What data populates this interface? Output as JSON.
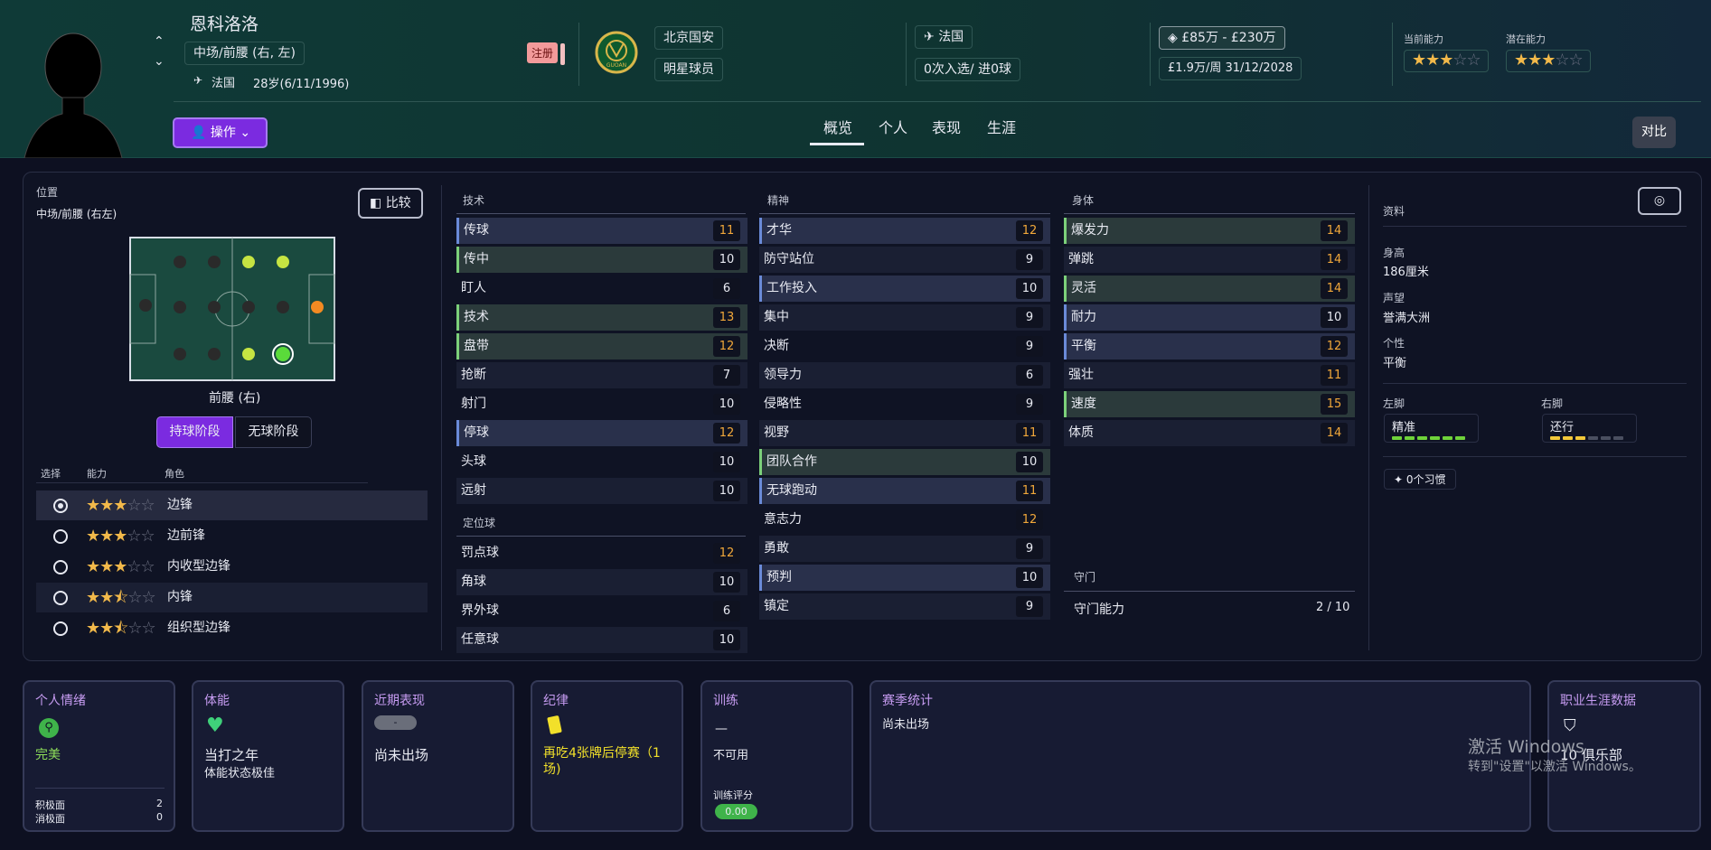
{
  "player": {
    "name": "恩科洛洛",
    "position": "中场/前腰 (右, 左)",
    "nationality": "法国",
    "age_dob": "28岁(6/11/1996)",
    "registered_badge": "注册",
    "club": "北京国安",
    "club_logo_text": "GUOAN",
    "status": "明星球员",
    "nation_team": "法国",
    "caps": "0次入选/ 进0球",
    "value": "£85万 - £230万",
    "wage_contract": "£1.9万/周  31/12/2028",
    "current_ability_label": "当前能力",
    "potential_ability_label": "潜在能力",
    "current_ability_stars": 3,
    "potential_ability_stars": 3
  },
  "actions_button": "操作",
  "tabs": [
    "概览",
    "个人",
    "表现",
    "生涯"
  ],
  "active_tab": "概览",
  "compare_top_button": "对比",
  "position_panel": {
    "label": "位置",
    "value": "中场/前腰 (右左)",
    "compare_button": "比较",
    "pitch_caption": "前腰 (右)",
    "phase_in": "持球阶段",
    "phase_out": "无球阶段",
    "col_select": "选择",
    "col_ability": "能力",
    "col_role": "角色",
    "roles": [
      {
        "name": "边锋",
        "stars": 3,
        "selected": true
      },
      {
        "name": "边前锋",
        "stars": 3,
        "selected": false
      },
      {
        "name": "内收型边锋",
        "stars": 3,
        "selected": false
      },
      {
        "name": "内锋",
        "stars": 2.5,
        "selected": false
      },
      {
        "name": "组织型边锋",
        "stars": 2.5,
        "selected": false
      }
    ]
  },
  "technical": {
    "title": "技术",
    "attrs": [
      {
        "name": "传球",
        "value": "11",
        "style": "hb"
      },
      {
        "name": "传中",
        "value": "10",
        "style": "hl"
      },
      {
        "name": "盯人",
        "value": "6",
        "style": "pl"
      },
      {
        "name": "技术",
        "value": "13",
        "style": "hl"
      },
      {
        "name": "盘带",
        "value": "12",
        "style": "hl"
      },
      {
        "name": "抢断",
        "value": "7",
        "style": "pl"
      },
      {
        "name": "射门",
        "value": "10",
        "style": "pl"
      },
      {
        "name": "停球",
        "value": "12",
        "style": "hb"
      },
      {
        "name": "头球",
        "value": "10",
        "style": "pl"
      },
      {
        "name": "远射",
        "value": "10",
        "style": "pl"
      }
    ]
  },
  "set_pieces": {
    "title": "定位球",
    "attrs": [
      {
        "name": "罚点球",
        "value": "12",
        "style": "pl"
      },
      {
        "name": "角球",
        "value": "10",
        "style": "pl"
      },
      {
        "name": "界外球",
        "value": "6",
        "style": "pl"
      },
      {
        "name": "任意球",
        "value": "10",
        "style": "pl"
      }
    ]
  },
  "mental": {
    "title": "精神",
    "attrs": [
      {
        "name": "才华",
        "value": "12",
        "style": "hb"
      },
      {
        "name": "防守站位",
        "value": "9",
        "style": "pl"
      },
      {
        "name": "工作投入",
        "value": "10",
        "style": "hb"
      },
      {
        "name": "集中",
        "value": "9",
        "style": "pl"
      },
      {
        "name": "决断",
        "value": "9",
        "style": "pl"
      },
      {
        "name": "领导力",
        "value": "6",
        "style": "pl"
      },
      {
        "name": "侵略性",
        "value": "9",
        "style": "pl"
      },
      {
        "name": "视野",
        "value": "11",
        "style": "pl"
      },
      {
        "name": "团队合作",
        "value": "10",
        "style": "hl"
      },
      {
        "name": "无球跑动",
        "value": "11",
        "style": "hb"
      },
      {
        "name": "意志力",
        "value": "12",
        "style": "pl"
      },
      {
        "name": "勇敢",
        "value": "9",
        "style": "pl"
      },
      {
        "name": "预判",
        "value": "10",
        "style": "hb"
      },
      {
        "name": "镇定",
        "value": "9",
        "style": "pl"
      }
    ]
  },
  "physical": {
    "title": "身体",
    "attrs": [
      {
        "name": "爆发力",
        "value": "14",
        "style": "hl"
      },
      {
        "name": "弹跳",
        "value": "14",
        "style": "pl"
      },
      {
        "name": "灵活",
        "value": "14",
        "style": "hl"
      },
      {
        "name": "耐力",
        "value": "10",
        "style": "hb"
      },
      {
        "name": "平衡",
        "value": "12",
        "style": "hb"
      },
      {
        "name": "强壮",
        "value": "11",
        "style": "pl"
      },
      {
        "name": "速度",
        "value": "15",
        "style": "hl"
      },
      {
        "name": "体质",
        "value": "14",
        "style": "pl"
      }
    ]
  },
  "goalkeeping": {
    "title": "守门",
    "label": "守门能力",
    "value": "2 / 10"
  },
  "info": {
    "title": "资料",
    "height_label": "身高",
    "height": "186厘米",
    "rep_label": "声望",
    "rep": "誉满大洲",
    "pers_label": "个性",
    "pers": "平衡",
    "left_foot_label": "左脚",
    "left_foot": "精准",
    "right_foot_label": "右脚",
    "right_foot": "还行",
    "left_foot_level": 5,
    "right_foot_level": 3,
    "habits": "0个习惯"
  },
  "cards": {
    "morale": {
      "title": "个人情绪",
      "value": "完美",
      "pos_label": "积极面",
      "pos": "2",
      "neg_label": "消极面",
      "neg": "0"
    },
    "fitness": {
      "title": "体能",
      "value": "当打之年",
      "sub": "体能状态极佳"
    },
    "form": {
      "title": "近期表现",
      "badge": "-",
      "value": "尚未出场"
    },
    "discipline": {
      "title": "纪律",
      "value": "再吃4张牌后停赛（1场)"
    },
    "training": {
      "title": "训练",
      "dash": "—",
      "value": "不可用",
      "rating_label": "训练评分",
      "rating": "0.00"
    },
    "season": {
      "title": "赛季统计",
      "value": "尚未出场"
    },
    "career": {
      "title": "职业生涯数据",
      "value": "10 俱乐部"
    }
  },
  "watermark": {
    "line1": "激活 Windows",
    "line2": "转到\"设置\"以激活 Windows。"
  },
  "colors": {
    "accent_purple": "#7b2be0",
    "green_high": "#7cd07a",
    "blue_high": "#6a8ad8",
    "orange_value": "#f2a83a"
  }
}
